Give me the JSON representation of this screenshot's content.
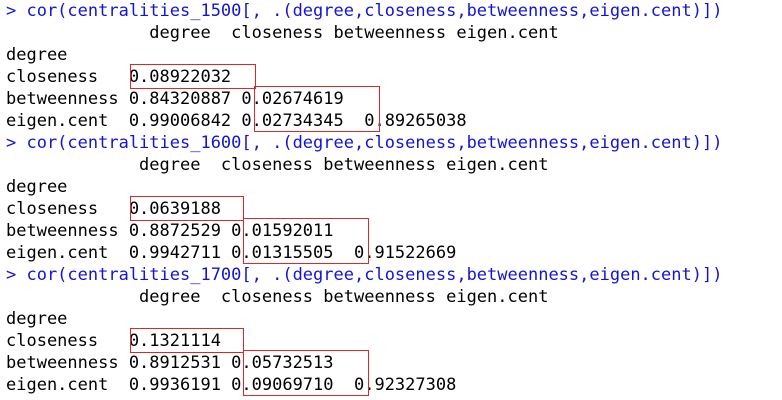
{
  "blocks": [
    {
      "command": "> cor(centralities_1500[, .(degree,closeness,betweenness,eigen.cent)])",
      "header": "              degree  closeness betweenness eigen.cent",
      "rows": [
        "degree",
        "closeness   0.08922032",
        "betweenness 0.84320887 0.02674619",
        "eigen.cent  0.99006842 0.02734345  0.89265038"
      ]
    },
    {
      "command": "> cor(centralities_1600[, .(degree,closeness,betweenness,eigen.cent)])",
      "header": "             degree  closeness betweenness eigen.cent",
      "rows": [
        "degree",
        "closeness   0.0639188",
        "betweenness 0.8872529 0.01592011",
        "eigen.cent  0.9942711 0.01315505  0.91522669"
      ]
    },
    {
      "command": "> cor(centralities_1700[, .(degree,closeness,betweenness,eigen.cent)])",
      "header": "             degree  closeness betweenness eigen.cent",
      "rows": [
        "degree",
        "closeness   0.1321114",
        "betweenness 0.8912531 0.05732513",
        "eigen.cent  0.9936191 0.09069710  0.92327308"
      ]
    }
  ],
  "colors": {
    "command": "#1414d4",
    "output": "#000000",
    "highlight_box": "#d82a2a"
  }
}
